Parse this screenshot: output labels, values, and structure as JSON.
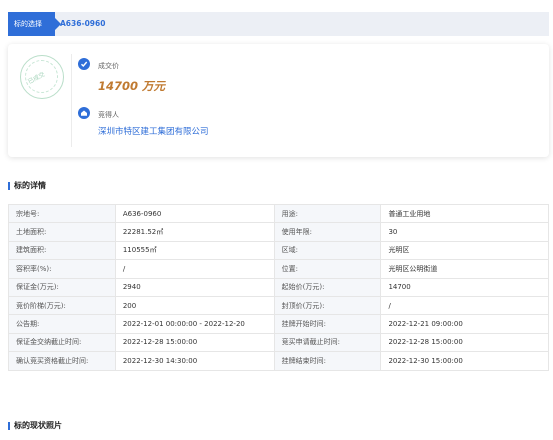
{
  "breadcrumb": {
    "tab": "标的选择",
    "code": "A636-0960"
  },
  "result": {
    "stamp_text": "已成交",
    "deal_label": "成交价",
    "deal_price": "14700 万元",
    "winner_label": "竞得人",
    "winner_name": "深圳市特区建工集团有限公司",
    "winner_icon_text": "🏠"
  },
  "sections": {
    "details": "标的详情",
    "photos": "标的现状照片"
  },
  "details": [
    {
      "k1": "宗地号:",
      "v1": "A636-0960",
      "k2": "用途:",
      "v2": "普通工业用地"
    },
    {
      "k1": "土地面积:",
      "v1": "22281.52㎡",
      "k2": "使用年限:",
      "v2": "30"
    },
    {
      "k1": "建筑面积:",
      "v1": "110555㎡",
      "k2": "区域:",
      "v2": "光明区"
    },
    {
      "k1": "容积率(%):",
      "v1": "/",
      "k2": "位置:",
      "v2": "光明区公明街道"
    },
    {
      "k1": "保证金(万元):",
      "v1": "2940",
      "k2": "起始价(万元):",
      "v2": "14700"
    },
    {
      "k1": "竞价阶梯(万元):",
      "v1": "200",
      "k2": "封顶价(万元):",
      "v2": "/"
    },
    {
      "k1": "公告期:",
      "v1": "2022-12-01 00:00:00 - 2022-12-20",
      "k2": "挂牌开始时间:",
      "v2": "2022-12-21 09:00:00"
    },
    {
      "k1": "保证金交纳截止时间:",
      "v1": "2022-12-28 15:00:00",
      "k2": "竞买申请截止时间:",
      "v2": "2022-12-28 15:00:00"
    },
    {
      "k1": "确认竞买资格截止时间:",
      "v1": "2022-12-30 14:30:00",
      "k2": "挂牌结束时间:",
      "v2": "2022-12-30 15:00:00"
    }
  ]
}
